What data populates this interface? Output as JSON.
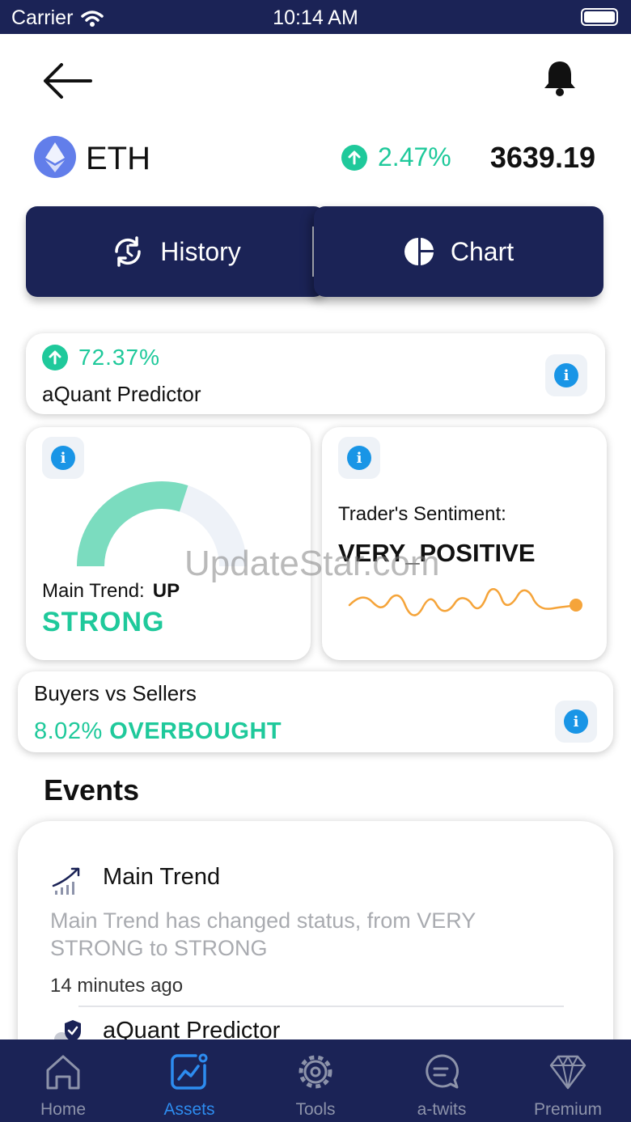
{
  "status_bar": {
    "carrier": "Carrier",
    "time": "10:14 AM"
  },
  "asset": {
    "symbol": "ETH",
    "change": "2.47%",
    "price": "3639.19",
    "change_direction": "up"
  },
  "segments": {
    "history_label": "History",
    "chart_label": "Chart"
  },
  "predictor": {
    "percent": "72.37%",
    "label": "aQuant Predictor"
  },
  "main_trend": {
    "label": "Main Trend:",
    "direction": "UP",
    "strength": "STRONG",
    "gauge_fill": 0.6
  },
  "sentiment": {
    "label": "Trader's Sentiment:",
    "value": "VERY_POSITIVE"
  },
  "watermark": "UpdateStar.com",
  "buyers_sellers": {
    "label": "Buyers vs Sellers",
    "percent": "8.02%",
    "status": "OVERBOUGHT"
  },
  "events": {
    "title": "Events",
    "items": [
      {
        "title": "Main Trend",
        "description": "Main Trend has changed status, from VERY STRONG to STRONG",
        "time": "14 minutes ago",
        "icon": "trend-chart-icon"
      },
      {
        "title": "aQuant Predictor",
        "icon": "shield-check-icon"
      }
    ]
  },
  "tabs": [
    {
      "label": "Home",
      "icon": "home-icon",
      "active": false
    },
    {
      "label": "Assets",
      "icon": "assets-chart-icon",
      "active": true
    },
    {
      "label": "Tools",
      "icon": "gear-icon",
      "active": false
    },
    {
      "label": "a-twits",
      "icon": "chat-bubble-icon",
      "active": false
    },
    {
      "label": "Premium",
      "icon": "diamond-icon",
      "active": false
    }
  ],
  "colors": {
    "navy": "#1b2356",
    "green": "#1fc99b",
    "info_blue": "#1995e6",
    "accent_orange": "#f5a43a",
    "gauge_fill": "#7bdcbf",
    "active_tab": "#2d8cf0"
  }
}
